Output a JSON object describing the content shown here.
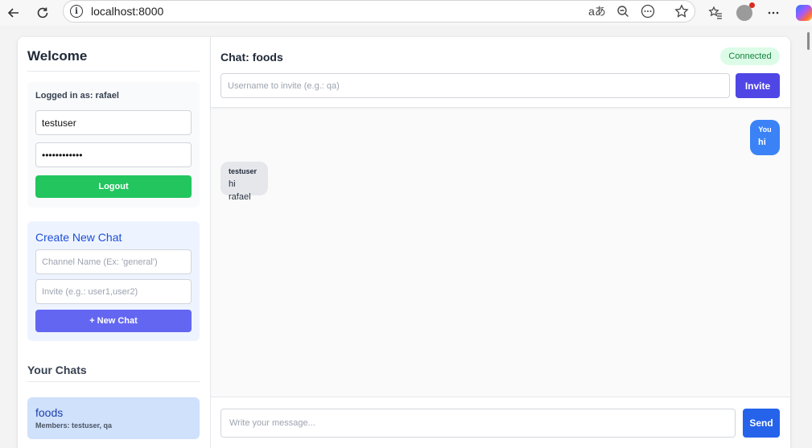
{
  "browser": {
    "url": "localhost:8000",
    "info_icon": "i",
    "read_aloud_icon": "aあ"
  },
  "sidebar": {
    "welcome_title": "Welcome",
    "login": {
      "logged_in_label": "Logged in as: rafael",
      "username_value": "testuser",
      "password_value": "••••••••••••",
      "logout_label": "Logout"
    },
    "create_chat": {
      "title": "Create New Chat",
      "channel_placeholder": "Channel Name (Ex: 'general')",
      "invite_placeholder": "Invite (e.g.: user1,user2)",
      "new_chat_label": "+ New Chat"
    },
    "your_chats_title": "Your Chats",
    "chats": [
      {
        "name": "foods",
        "members": "Members: testuser, qa"
      }
    ]
  },
  "main": {
    "chat_title": "Chat: foods",
    "status": "Connected",
    "invite_placeholder": "Username to invite (e.g.: qa)",
    "invite_label": "Invite",
    "messages": [
      {
        "sender": "You",
        "text": "hi",
        "mine": true
      },
      {
        "sender": "testuser",
        "text": "hi rafael",
        "mine": false
      }
    ],
    "composer_placeholder": "Write your message...",
    "send_label": "Send"
  },
  "colors": {
    "logout": "#22c55e",
    "new_chat": "#6366f1",
    "invite": "#4f46e5",
    "send": "#2563eb",
    "my_message": "#3b82f6",
    "connected_badge": "#dcfce7"
  }
}
